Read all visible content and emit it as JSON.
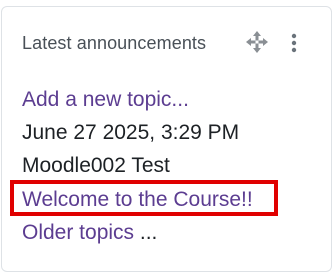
{
  "block": {
    "title": "Latest announcements",
    "icons": {
      "move": "move-arrows-icon",
      "menu": "kebab-menu-icon"
    },
    "add_topic_label": "Add a new topic...",
    "post": {
      "date": "June 27 2025, 3:29 PM",
      "author": "Moodle002 Test",
      "title": "Welcome to the Course!!"
    },
    "older_topics_label": "Older topics",
    "older_topics_suffix": " ..."
  },
  "colors": {
    "link": "#5c3d91",
    "text": "#1d2125",
    "header": "#495057",
    "border": "#dee2e6",
    "highlight": "#e00000"
  }
}
